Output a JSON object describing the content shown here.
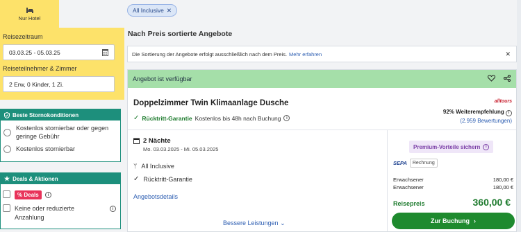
{
  "search": {
    "tab_label": "Nur Hotel",
    "travel_period_label": "Reisezeitraum",
    "travel_period_value": "03.03.25 - 05.03.25",
    "travelers_label": "Reiseteilnehmer & Zimmer",
    "travelers_value": "2 Erw, 0 Kinder, 1 Zi."
  },
  "filters": {
    "storno": {
      "title": "Beste Stornokonditionen",
      "options": [
        "Kostenlos stornierbar oder gegen geringe Gebühr",
        "Kostenlos stornierbar"
      ]
    },
    "deals": {
      "title": "Deals & Aktionen",
      "deal_tag": "% Deals",
      "option_text": "Keine oder reduzierte Anzahlung"
    }
  },
  "active_filter": {
    "label": "All Inclusive",
    "close": "✕"
  },
  "results": {
    "heading": "Nach Preis sortierte Angebote",
    "note": "Die Sortierung der Angebote erfolgt ausschließlich nach dem Preis.",
    "note_link": "Mehr erfahren",
    "note_close": "✕"
  },
  "offer": {
    "availability": "Angebot ist verfügbar",
    "room_title": "Doppelzimmer Twin Klimaanlage Dusche",
    "guarantee_title": "Rücktritt-Garantie",
    "guarantee_text": "Kostenlos bis 48h nach Buchung",
    "brand": "alltours",
    "recommendation": "92% Weiterempfehlung",
    "reviews": "(2.959 Bewertungen)",
    "nights": "2 Nächte",
    "dates": "Mo. 03.03.2025 - Mi. 05.03.2025",
    "board": "All Inclusive",
    "guarantee_short": "Rücktritt-Garantie",
    "details_link": "Angebotsdetails",
    "better_link": "Bessere Leistungen",
    "premium": "Premium-Vorteile sichern",
    "payment_sepa": "SEPA",
    "payment_invoice": "Rechnung",
    "price_lines": [
      {
        "label": "Erwachsener",
        "amount": "180,00 €"
      },
      {
        "label": "Erwachsener",
        "amount": "180,00 €"
      }
    ],
    "total_label": "Reisepreis",
    "total_price": "360,00 €",
    "book_button": "Zur Buchung"
  },
  "colors": {
    "yellow": "#fde26a",
    "teal": "#1d8f7c",
    "green": "#1e8a2e",
    "avail_green": "#a5dfa9",
    "link_blue": "#2c5db1",
    "deal_red": "#e8335a"
  }
}
